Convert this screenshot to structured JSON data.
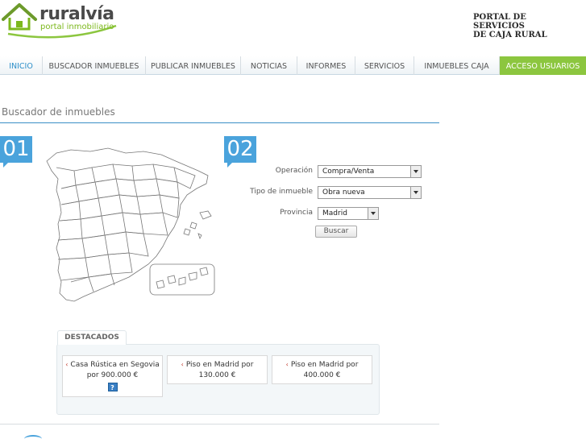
{
  "header": {
    "logo_word": "ruralvía",
    "logo_sub": "portal inmobiliario",
    "portal_title_line1": "PORTAL DE SERVICIOS",
    "portal_title_line2": "DE CAJA RURAL"
  },
  "nav": {
    "items": [
      {
        "label": "INICIO"
      },
      {
        "label": "BUSCADOR INMUEBLES"
      },
      {
        "label": "PUBLICAR INMUEBLES"
      },
      {
        "label": "NOTICIAS"
      },
      {
        "label": "INFORMES"
      },
      {
        "label": "SERVICIOS"
      },
      {
        "label": "INMUEBLES CAJA"
      },
      {
        "label": "ACCESO USUARIOS"
      }
    ],
    "active_index": 0
  },
  "main": {
    "section_title": "Buscador de inmuebles",
    "step1": "01",
    "step2": "02"
  },
  "form": {
    "operacion_label": "Operación",
    "operacion_value": "Compra/Venta",
    "tipo_label": "Tipo de inmueble",
    "tipo_value": "Obra nueva",
    "provincia_label": "Provincia",
    "provincia_value": "Madrid",
    "buscar_label": "Buscar"
  },
  "destacados": {
    "tab_label": "DESTACADOS",
    "items": [
      {
        "text": "Casa Rústica en Segovia por 900.000 €",
        "info": "?"
      },
      {
        "text": "Piso en Madrid por 130.000 €"
      },
      {
        "text": "Piso en Madrid por 400.000 €"
      }
    ]
  },
  "colors": {
    "accent_green": "#8cc63f",
    "accent_blue": "#4aa3dc",
    "active_link": "#2d8fc9"
  },
  "icons": {
    "logo": "house-roof-icon",
    "info": "info-icon",
    "bullet": "arrow-bullet-icon"
  }
}
